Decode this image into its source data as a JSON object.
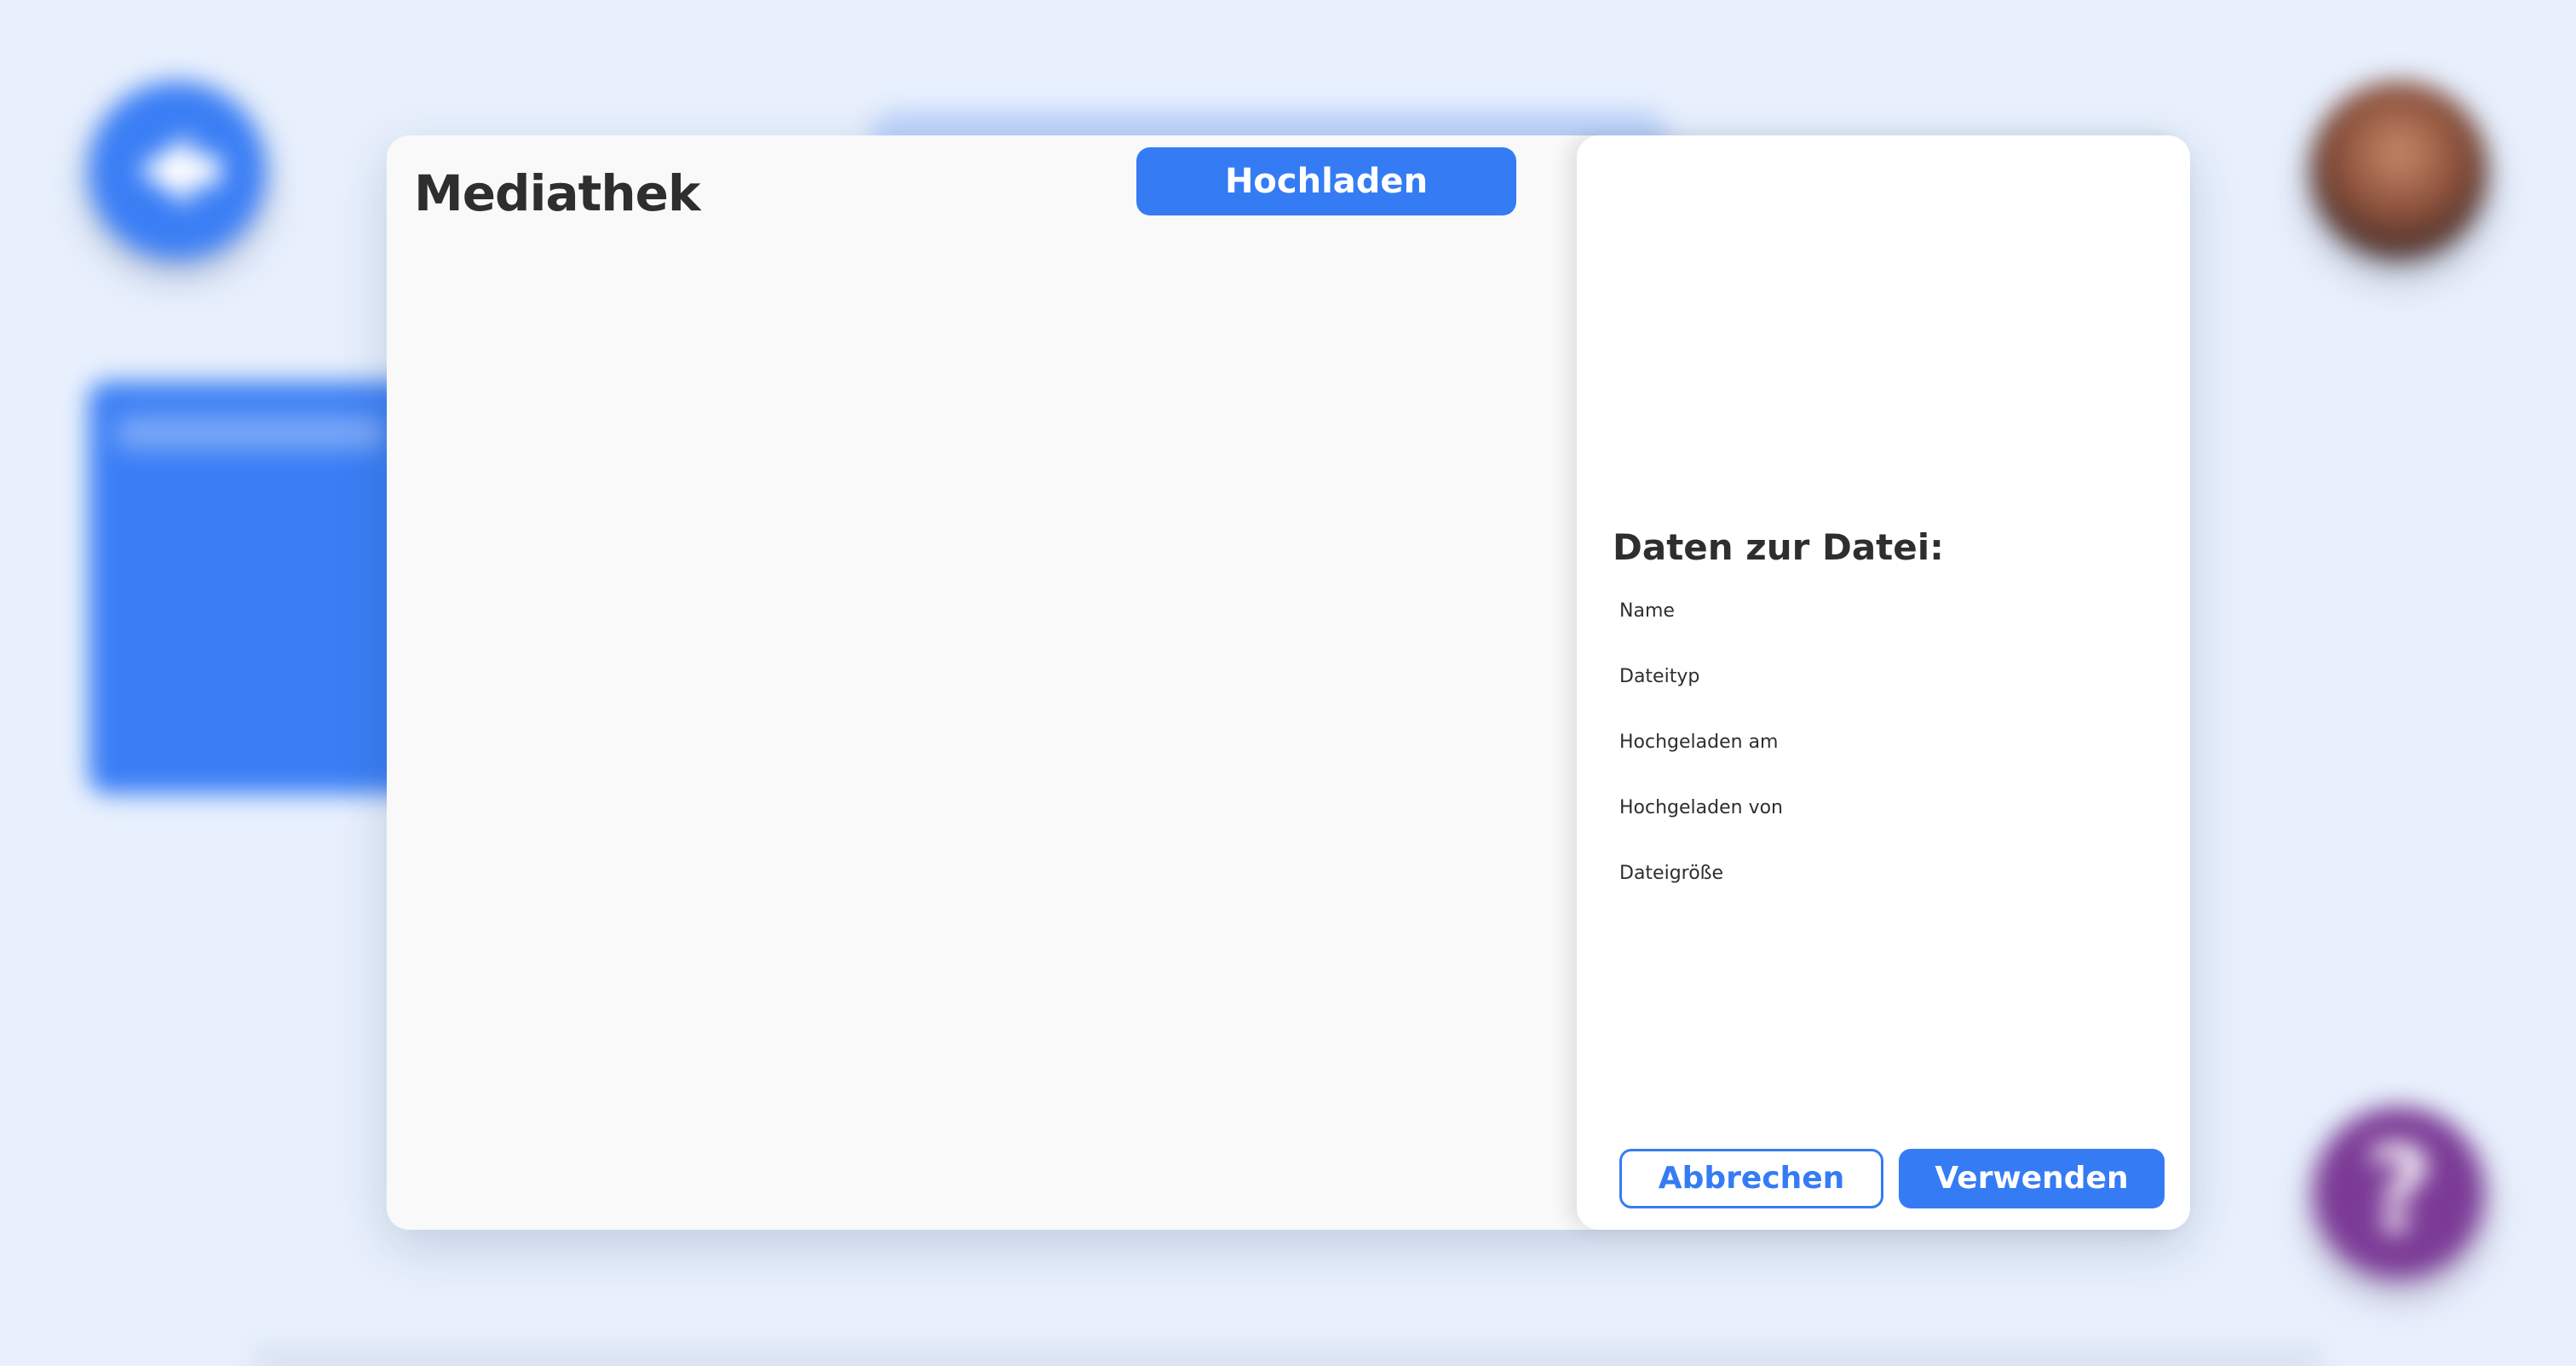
{
  "colors": {
    "accent": "#357cf4",
    "page_background": "#e8f0fd",
    "modal_background": "#f9f9f9",
    "panel_background": "#ffffff",
    "text": "#2e2e2e",
    "help_button": "#7b3a96"
  },
  "background": {
    "back_icon": "arrow-left-icon",
    "help_glyph": "?",
    "help_icon": "question-mark-icon"
  },
  "modal": {
    "title": "Mediathek",
    "upload_label": "Hochladen"
  },
  "details": {
    "heading": "Daten zur Datei:",
    "fields": [
      {
        "label": "Name"
      },
      {
        "label": "Dateityp"
      },
      {
        "label": "Hochgeladen am"
      },
      {
        "label": "Hochgeladen von"
      },
      {
        "label": "Dateigröße"
      }
    ],
    "cancel_label": "Abbrechen",
    "use_label": "Verwenden"
  }
}
